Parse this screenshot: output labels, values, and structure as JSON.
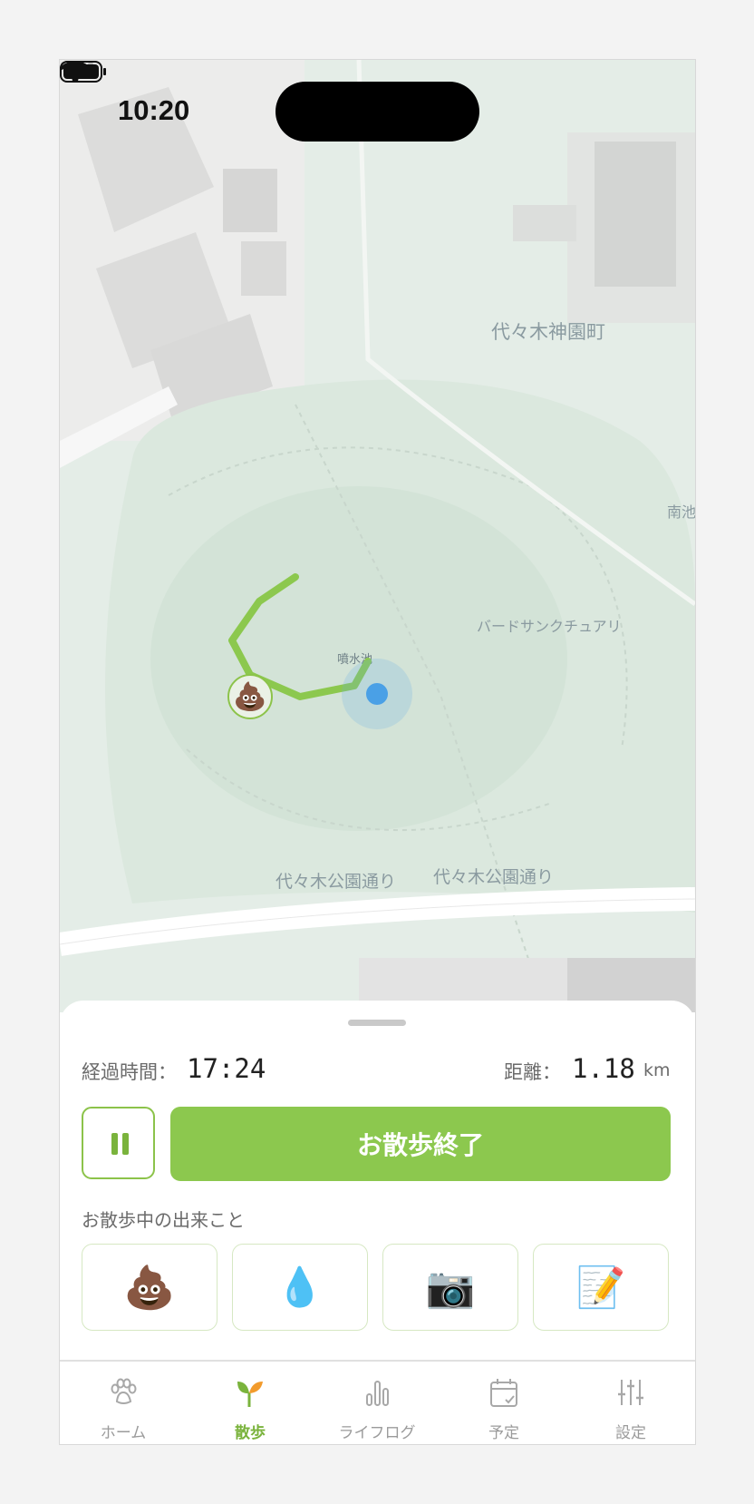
{
  "status_bar": {
    "time": "10:20"
  },
  "map": {
    "labels": {
      "yoyogi_kamizono": "代々木神園町",
      "minami_ike": "南池",
      "bird_sanctuary": "バードサンクチュアリ",
      "pond": "噴水池",
      "street_1": "代々木公園通り",
      "street_2": "代々木公園通り"
    },
    "marker_emoji": "💩"
  },
  "walk": {
    "elapsed_label": "経過時間：",
    "elapsed_value": "17:24",
    "distance_label": "距離：",
    "distance_value": "1.18",
    "distance_unit": "km",
    "end_button": "お散歩終了",
    "events_title": "お散歩中の出来こと",
    "events": [
      {
        "emoji": "💩",
        "icon": "poop-icon"
      },
      {
        "emoji": "💧",
        "icon": "water-drop-icon"
      },
      {
        "emoji": "📷",
        "icon": "camera-icon"
      },
      {
        "emoji": "📝",
        "icon": "memo-icon"
      }
    ]
  },
  "tabs": [
    {
      "label": "ホーム",
      "icon": "paw-icon"
    },
    {
      "label": "散歩",
      "icon": "sprout-icon",
      "active": true
    },
    {
      "label": "ライフログ",
      "icon": "bar-chart-icon"
    },
    {
      "label": "予定",
      "icon": "calendar-icon"
    },
    {
      "label": "設定",
      "icon": "sliders-icon"
    }
  ],
  "colors": {
    "accent": "#8cc84e",
    "user_dot": "#4aa0e6"
  }
}
